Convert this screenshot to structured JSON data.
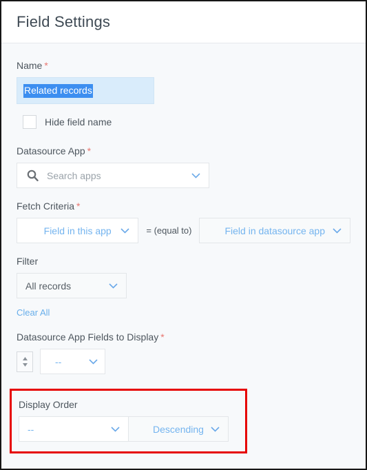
{
  "header": {
    "title": "Field Settings"
  },
  "form": {
    "name": {
      "label": "Name",
      "required_mark": "*",
      "value": "Related records",
      "hide_field_name_label": "Hide field name",
      "checkbox_icon": "checkbox-unchecked-icon"
    },
    "datasource_app": {
      "label": "Datasource App",
      "required_mark": "*",
      "search_placeholder": "Search apps",
      "search_icon": "search-icon",
      "chevron_icon": "chevron-down-icon"
    },
    "fetch_criteria": {
      "label": "Fetch Criteria",
      "required_mark": "*",
      "left_value": "Field in this app",
      "operator": "= (equal to)",
      "right_value": "Field in datasource app"
    },
    "filter": {
      "label": "Filter",
      "value": "All records",
      "clear_all_label": "Clear All"
    },
    "fields_to_display": {
      "label": "Datasource App Fields to Display",
      "required_mark": "*",
      "reorder_icon": "spinner-updown-icon",
      "value": "--"
    },
    "display_order": {
      "label": "Display Order",
      "field_value": "--",
      "direction_value": "Descending",
      "highlight_color": "#e60000"
    }
  },
  "colors": {
    "accent_blue": "#74b4ef",
    "selection_blue": "#3c8ef0",
    "required_red": "#e8766f",
    "highlight_red": "#e60000",
    "label_gray": "#4c555d",
    "page_bg": "#f7f9fb"
  }
}
